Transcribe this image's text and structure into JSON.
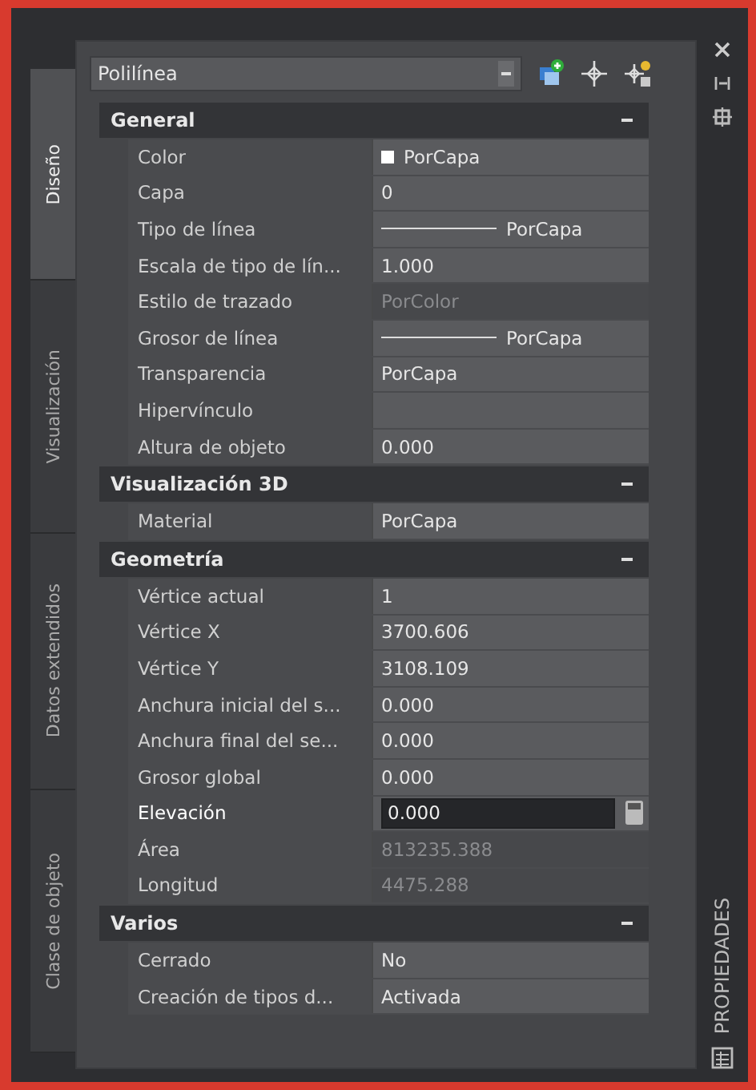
{
  "side_tabs": [
    {
      "label": "Diseño",
      "selected": true
    },
    {
      "label": "Visualización",
      "selected": false
    },
    {
      "label": "Datos extendidos",
      "selected": false
    },
    {
      "label": "Clase de objeto",
      "selected": false
    }
  ],
  "object_selector": {
    "value": "Polilínea"
  },
  "sections": [
    {
      "title": "General",
      "expanded": true,
      "rows": [
        {
          "label": "Color",
          "value": "PorCapa",
          "kind": "color",
          "disabled": false,
          "selected": false
        },
        {
          "label": "Capa",
          "value": "0",
          "kind": "text",
          "disabled": false,
          "selected": false
        },
        {
          "label": "Tipo de línea",
          "value": "PorCapa",
          "kind": "line",
          "disabled": false,
          "selected": false
        },
        {
          "label": "Escala de tipo de lín...",
          "value": "1.000",
          "kind": "text",
          "disabled": false,
          "selected": false
        },
        {
          "label": "Estilo de trazado",
          "value": "PorColor",
          "kind": "text",
          "disabled": true,
          "selected": false
        },
        {
          "label": "Grosor de línea",
          "value": "PorCapa",
          "kind": "line",
          "disabled": false,
          "selected": false
        },
        {
          "label": "Transparencia",
          "value": "PorCapa",
          "kind": "text",
          "disabled": false,
          "selected": false
        },
        {
          "label": "Hipervínculo",
          "kind": "text",
          "disabled": false,
          "selected": false
        },
        {
          "label": "Altura de objeto",
          "value": "0.000",
          "kind": "text",
          "disabled": false,
          "selected": false
        }
      ]
    },
    {
      "title": "Visualización 3D",
      "expanded": true,
      "rows": [
        {
          "label": "Material",
          "value": "PorCapa",
          "kind": "text",
          "disabled": false,
          "selected": false
        }
      ]
    },
    {
      "title": "Geometría",
      "expanded": true,
      "rows": [
        {
          "label": "Vértice actual",
          "value": "1",
          "kind": "text",
          "disabled": false,
          "selected": false
        },
        {
          "label": "Vértice X",
          "value": "3700.606",
          "kind": "text",
          "disabled": false,
          "selected": false
        },
        {
          "label": "Vértice Y",
          "value": "3108.109",
          "kind": "text",
          "disabled": false,
          "selected": false
        },
        {
          "label": "Anchura inicial del s...",
          "value": "0.000",
          "kind": "text",
          "disabled": false,
          "selected": false
        },
        {
          "label": "Anchura final del se...",
          "value": "0.000",
          "kind": "text",
          "disabled": false,
          "selected": false
        },
        {
          "label": "Grosor global",
          "value": "0.000",
          "kind": "text",
          "disabled": false,
          "selected": false
        },
        {
          "label": "Elevación",
          "value": "0.000",
          "kind": "field",
          "disabled": false,
          "selected": true
        },
        {
          "label": "Área",
          "value": "813235.388",
          "kind": "text",
          "disabled": true,
          "selected": false
        },
        {
          "label": "Longitud",
          "value": "4475.288",
          "kind": "text",
          "disabled": true,
          "selected": false
        }
      ]
    },
    {
      "title": "Varios",
      "expanded": true,
      "rows": [
        {
          "label": "Cerrado",
          "value": "No",
          "kind": "text",
          "disabled": false,
          "selected": false
        },
        {
          "label": "Creación de tipos d...",
          "value": "Activada",
          "kind": "text",
          "disabled": false,
          "selected": false
        }
      ]
    }
  ],
  "palette_title": "PROPIEDADES"
}
